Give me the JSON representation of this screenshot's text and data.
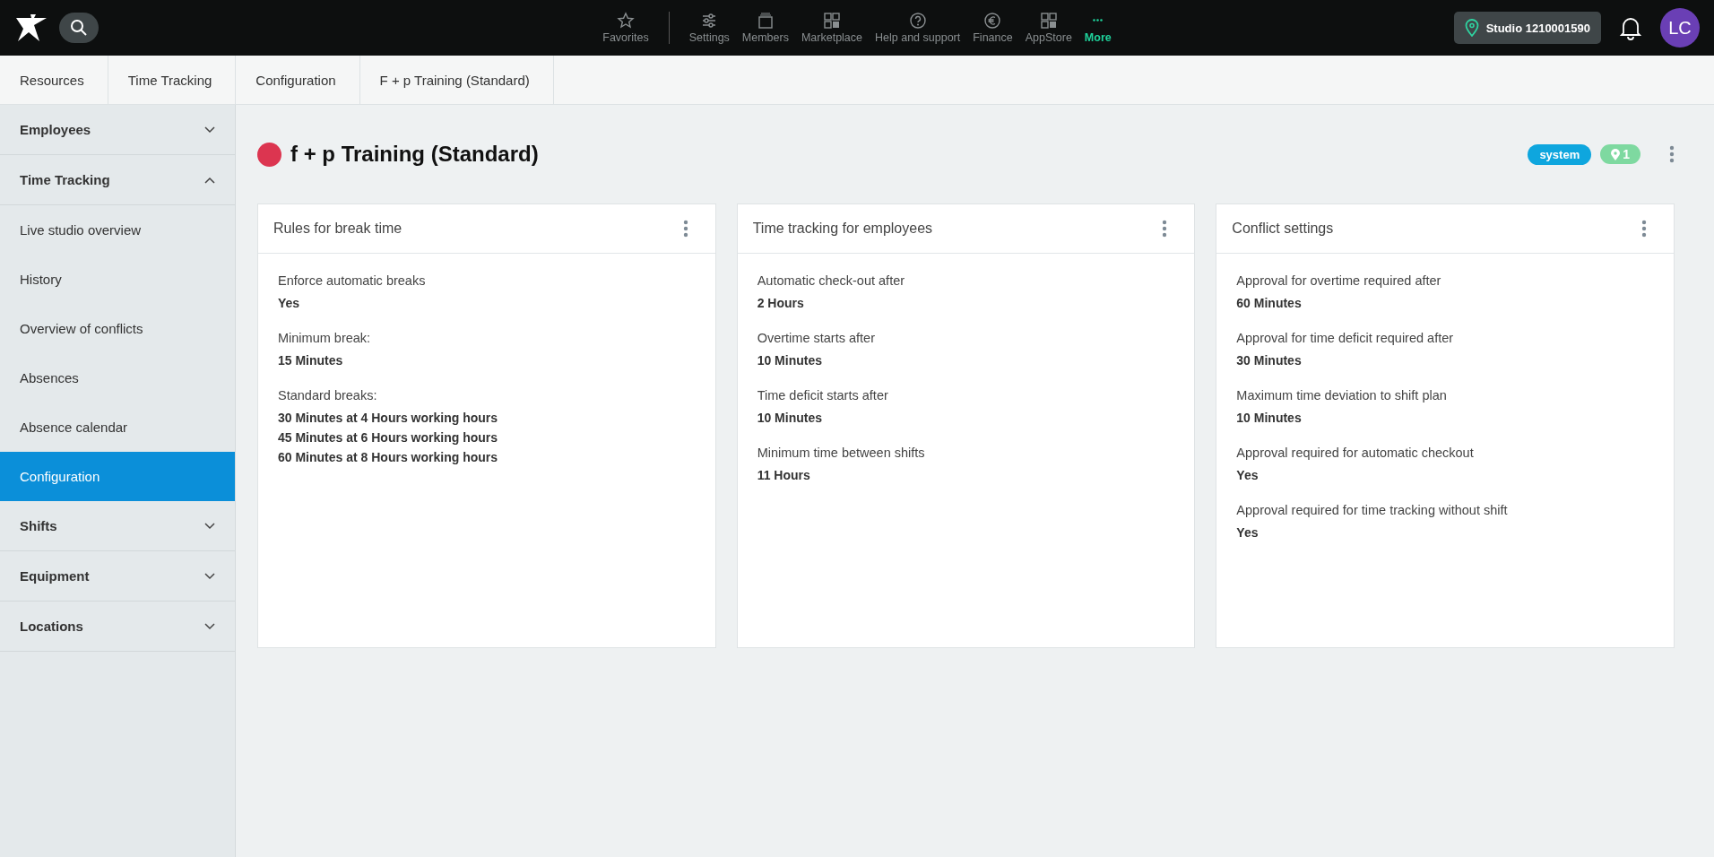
{
  "top_nav": {
    "items": [
      {
        "label": "Favorites",
        "kind": "star",
        "selected": false
      },
      {
        "label": "Settings",
        "kind": "sliders",
        "selected": false
      },
      {
        "label": "Members",
        "kind": "members",
        "selected": false
      },
      {
        "label": "Marketplace",
        "kind": "grid",
        "selected": false
      },
      {
        "label": "Help and support",
        "kind": "help",
        "selected": false
      },
      {
        "label": "Finance",
        "kind": "euro",
        "selected": false
      },
      {
        "label": "AppStore",
        "kind": "grid",
        "selected": false
      },
      {
        "label": "More",
        "kind": "dots",
        "selected": true
      }
    ],
    "studio": "Studio 1210001590",
    "avatar": "LC"
  },
  "breadcrumb": [
    "Resources",
    "Time Tracking",
    "Configuration",
    "F + p Training (Standard)"
  ],
  "sidebar": {
    "items": [
      {
        "label": "Employees",
        "expanded": false,
        "selected": false
      },
      {
        "label": "Time Tracking",
        "expanded": true,
        "selected": false,
        "children": [
          {
            "label": "Live studio overview",
            "selected": false
          },
          {
            "label": "History",
            "selected": false
          },
          {
            "label": "Overview of conflicts",
            "selected": false
          },
          {
            "label": "Absences",
            "selected": false
          },
          {
            "label": "Absence calendar",
            "selected": false
          },
          {
            "label": "Configuration",
            "selected": true
          }
        ]
      },
      {
        "label": "Shifts",
        "expanded": false,
        "selected": false
      },
      {
        "label": "Equipment",
        "expanded": false,
        "selected": false
      },
      {
        "label": "Locations",
        "expanded": false,
        "selected": false
      }
    ]
  },
  "page": {
    "title": "f + p Training (Standard)",
    "color": "#dc3550",
    "tag": "system",
    "location_count": "1"
  },
  "cards": [
    {
      "title": "Rules for break time",
      "fields": [
        {
          "label": "Enforce automatic breaks",
          "values": [
            "Yes"
          ]
        },
        {
          "label": "Minimum break:",
          "values": [
            "15 Minutes"
          ]
        },
        {
          "label": "Standard breaks:",
          "values": [
            "30 Minutes at 4 Hours working hours",
            "45 Minutes at 6 Hours working hours",
            "60 Minutes at 8 Hours working hours"
          ]
        }
      ]
    },
    {
      "title": "Time tracking for employees",
      "fields": [
        {
          "label": "Automatic check-out after",
          "values": [
            "2 Hours"
          ]
        },
        {
          "label": "Overtime starts after",
          "values": [
            "10 Minutes"
          ]
        },
        {
          "label": "Time deficit starts after",
          "values": [
            "10 Minutes"
          ]
        },
        {
          "label": "Minimum time between shifts",
          "values": [
            "11 Hours"
          ]
        }
      ]
    },
    {
      "title": "Conflict settings",
      "fields": [
        {
          "label": "Approval for overtime required after",
          "values": [
            "60 Minutes"
          ]
        },
        {
          "label": "Approval for time deficit required after",
          "values": [
            "30 Minutes"
          ]
        },
        {
          "label": "Maximum time deviation to shift plan",
          "values": [
            "10 Minutes"
          ]
        },
        {
          "label": "Approval required for automatic checkout",
          "values": [
            "Yes"
          ]
        },
        {
          "label": "Approval required for time tracking without shift",
          "values": [
            "Yes"
          ]
        }
      ]
    }
  ]
}
